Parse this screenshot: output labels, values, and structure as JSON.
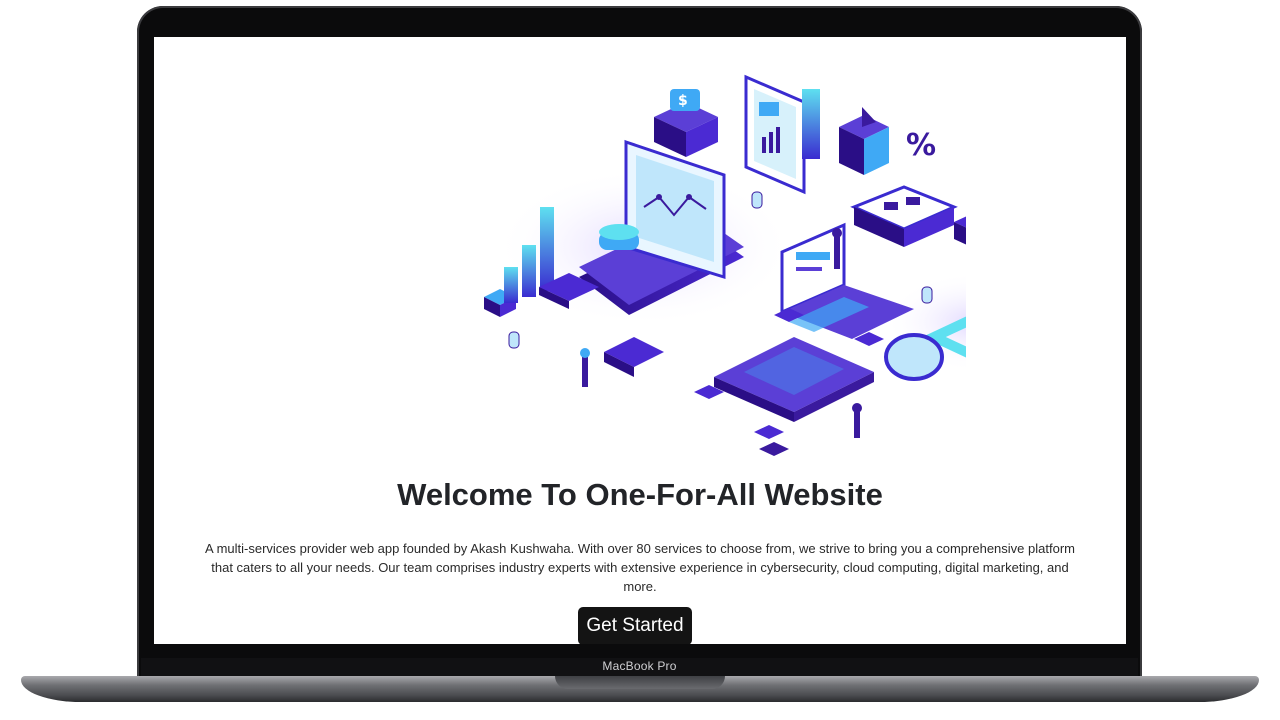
{
  "hero": {
    "title": "Welcome To One-For-All Website",
    "description": "A multi-services provider web app founded by Akash Kushwaha. With over 80 services to choose from, we strive to bring you a comprehensive platform that caters to all your needs. Our team comprises industry experts with extensive experience in cybersecurity, cloud computing, digital marketing, and more.",
    "cta_label": "Get Started",
    "illustration_icon": "isometric-tech-illustration",
    "percent_symbol": "%",
    "dollar_symbol": "$"
  },
  "device": {
    "label": "MacBook Pro"
  },
  "colors": {
    "accent_dark": "#3a1a9e",
    "accent_mid": "#5b3fd6",
    "accent_light": "#3fa9f5",
    "cyan": "#5ee0f0",
    "button_bg": "#141414",
    "title_text": "#222428"
  }
}
